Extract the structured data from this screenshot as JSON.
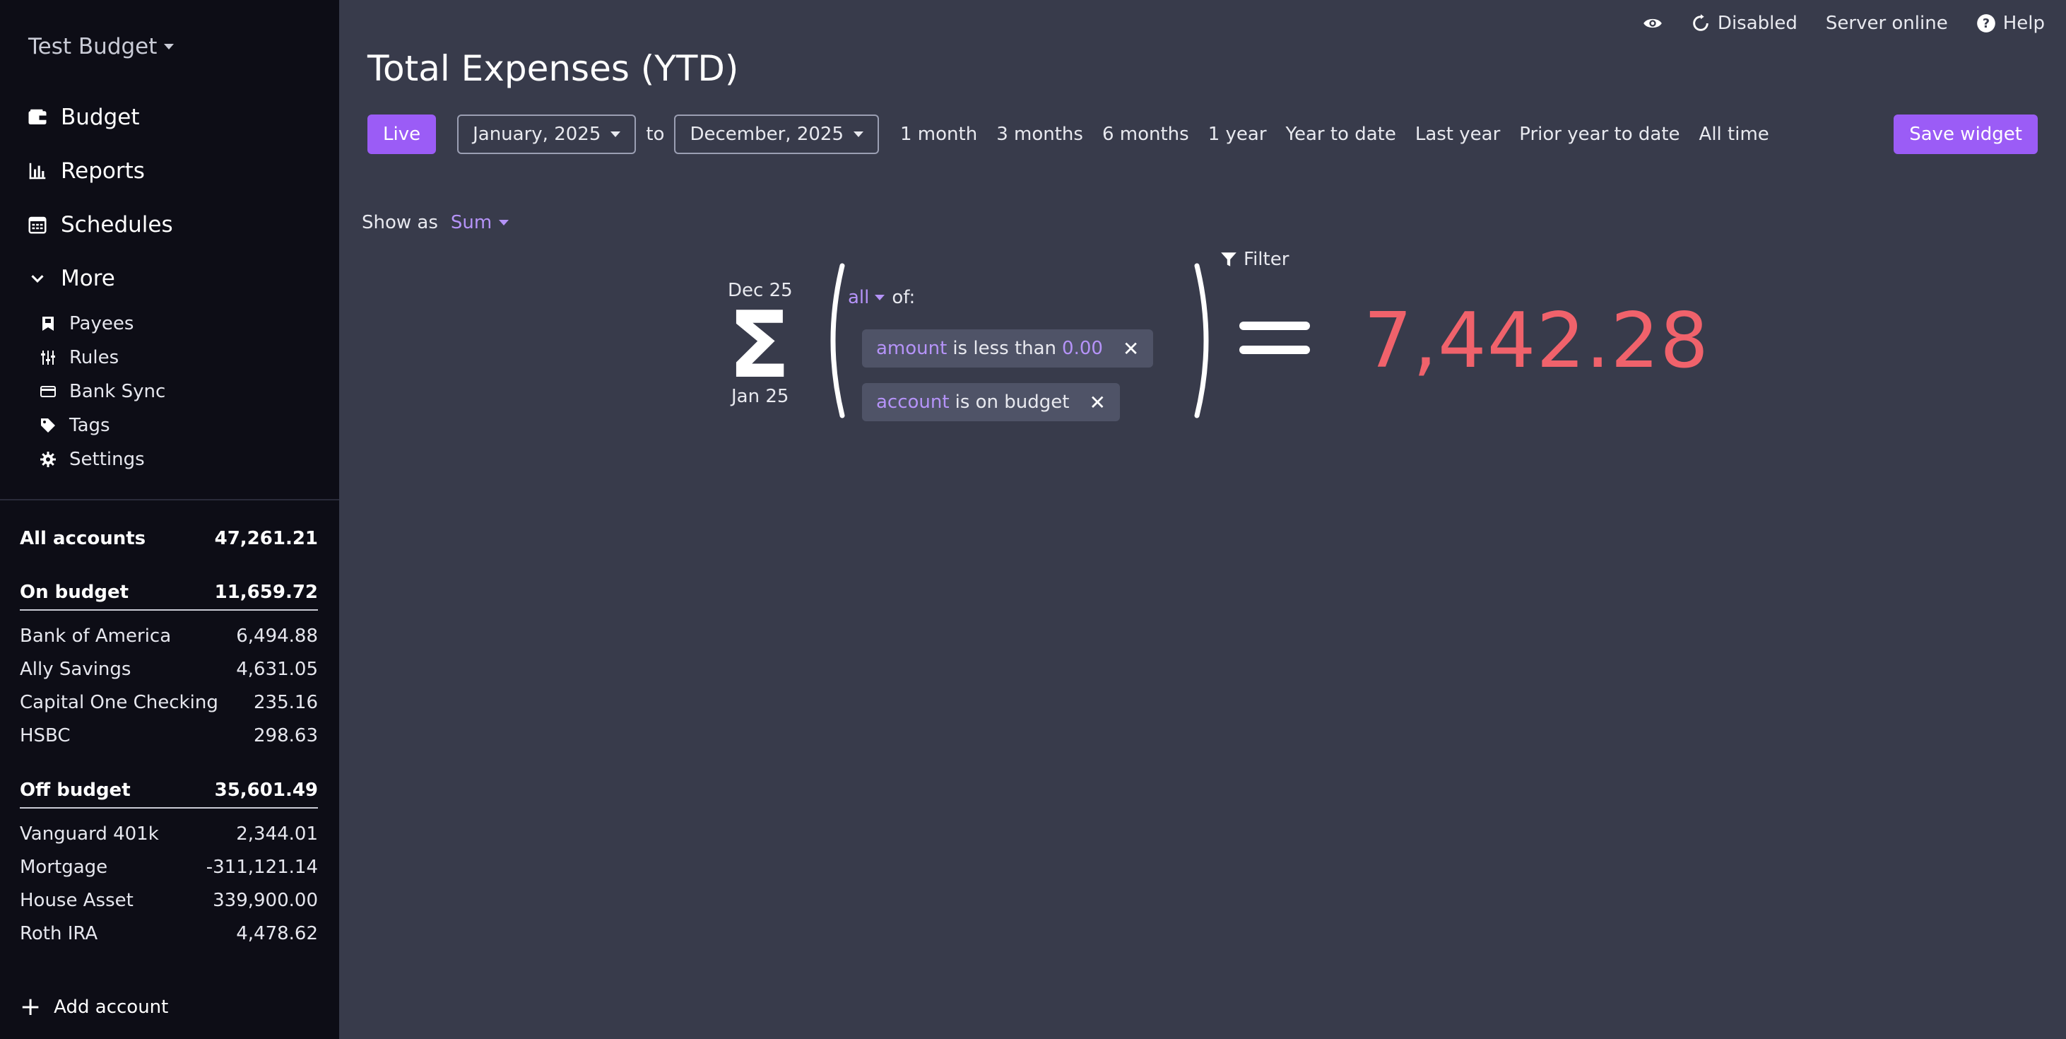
{
  "sidebar": {
    "budget_name": "Test Budget",
    "nav": [
      {
        "label": "Budget",
        "icon": "wallet-icon"
      },
      {
        "label": "Reports",
        "icon": "bar-chart-icon"
      },
      {
        "label": "Schedules",
        "icon": "calendar-icon"
      },
      {
        "label": "More",
        "icon": "chevron-down-icon"
      }
    ],
    "subnav": [
      {
        "label": "Payees",
        "icon": "payee-icon"
      },
      {
        "label": "Rules",
        "icon": "sliders-icon"
      },
      {
        "label": "Bank Sync",
        "icon": "card-icon"
      },
      {
        "label": "Tags",
        "icon": "tag-icon"
      },
      {
        "label": "Settings",
        "icon": "gear-icon"
      }
    ],
    "accounts": {
      "all": {
        "label": "All accounts",
        "balance": "47,261.21"
      },
      "on_budget": {
        "label": "On budget",
        "balance": "11,659.72",
        "items": [
          {
            "name": "Bank of America",
            "balance": "6,494.88"
          },
          {
            "name": "Ally Savings",
            "balance": "4,631.05"
          },
          {
            "name": "Capital One Checking",
            "balance": "235.16"
          },
          {
            "name": "HSBC",
            "balance": "298.63"
          }
        ]
      },
      "off_budget": {
        "label": "Off budget",
        "balance": "35,601.49",
        "items": [
          {
            "name": "Vanguard 401k",
            "balance": "2,344.01"
          },
          {
            "name": "Mortgage",
            "balance": "-311,121.14"
          },
          {
            "name": "House Asset",
            "balance": "339,900.00"
          },
          {
            "name": "Roth IRA",
            "balance": "4,478.62"
          }
        ]
      }
    },
    "add_account": "Add account"
  },
  "topbar": {
    "sync_status": "Disabled",
    "server_status": "Server online",
    "help": "Help"
  },
  "page": {
    "title": "Total Expenses (YTD)",
    "live_label": "Live",
    "start_month": "January, 2025",
    "to_label": "to",
    "end_month": "December, 2025",
    "ranges": [
      "1 month",
      "3 months",
      "6 months",
      "1 year",
      "Year to date",
      "Last year",
      "Prior year to date",
      "All time"
    ],
    "save_widget": "Save widget",
    "show_as_label": "Show as",
    "show_as_value": "Sum",
    "filter_label": "Filter"
  },
  "formula": {
    "upper_date": "Dec 25",
    "lower_date": "Jan 25",
    "conditions_op": "all",
    "conditions_suffix": "of:",
    "conditions": [
      {
        "field": "amount",
        "op": "is less than",
        "value": "0.00"
      },
      {
        "field": "account",
        "op": "is on budget",
        "value": ""
      }
    ],
    "total": "7,442.28"
  },
  "colors": {
    "accent": "#9b5cf6",
    "accent_text": "#b593f8",
    "negative": "#f0626b",
    "sidebar_bg": "#0d0d16",
    "main_bg": "#383b4b"
  }
}
